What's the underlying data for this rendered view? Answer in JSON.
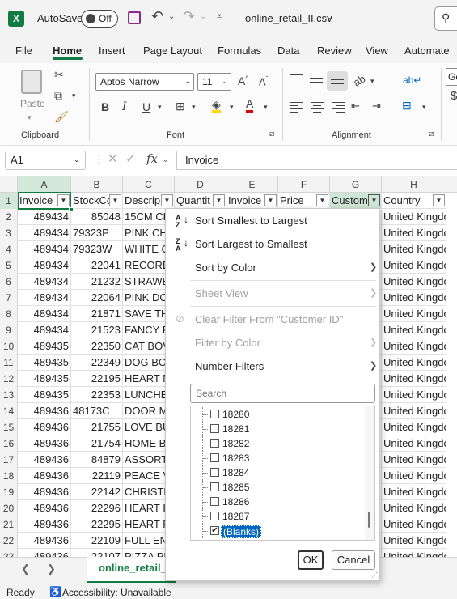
{
  "titlebar": {
    "logo": "X",
    "autosave_label": "AutoSave",
    "autosave_state": "Off",
    "file_name": "online_retail_II.csv",
    "icons": [
      "excel-logo-icon",
      "save-icon",
      "undo-icon",
      "redo-icon",
      "customize-qat-icon",
      "search-icon"
    ]
  },
  "ribbon_tabs": [
    "File",
    "Home",
    "Insert",
    "Page Layout",
    "Formulas",
    "Data",
    "Review",
    "View",
    "Automate"
  ],
  "ribbon": {
    "clipboard": {
      "label": "Clipboard",
      "paste": "Paste"
    },
    "font": {
      "label": "Font",
      "name": "Aptos Narrow",
      "size": "11",
      "bold": "B",
      "italic": "I",
      "underline": "U"
    },
    "alignment": {
      "label": "Alignment"
    },
    "next_group_stub": "Ge"
  },
  "formula_bar": {
    "namebox": "A1",
    "fx": "fx",
    "formula": "Invoice"
  },
  "grid": {
    "columns": [
      "A",
      "B",
      "C",
      "D",
      "E",
      "F",
      "G",
      "H"
    ],
    "headers": [
      "Invoice",
      "StockCo",
      "Descrip",
      "Quantit",
      "Invoice",
      "Price",
      "Custom",
      "Country"
    ],
    "rows": [
      {
        "n": "1"
      },
      {
        "n": "2",
        "a": "489434",
        "b": "85048",
        "c": "15CM CH",
        "h": "United Kingdom"
      },
      {
        "n": "3",
        "a": "489434",
        "b": "79323P",
        "c": "PINK CH",
        "h": "United Kingdom"
      },
      {
        "n": "4",
        "a": "489434",
        "b": "79323W",
        "c": " WHITE C",
        "h": "United Kingdom"
      },
      {
        "n": "5",
        "a": "489434",
        "b": "22041",
        "c": "RECORD",
        "h": "United Kingdom"
      },
      {
        "n": "6",
        "a": "489434",
        "b": "21232",
        "c": "STRAWB",
        "h": "United Kingdom"
      },
      {
        "n": "7",
        "a": "489434",
        "b": "22064",
        "c": "PINK DO",
        "h": "United Kingdom"
      },
      {
        "n": "8",
        "a": "489434",
        "b": "21871",
        "c": "SAVE TH",
        "h": "United Kingdom"
      },
      {
        "n": "9",
        "a": "489434",
        "b": "21523",
        "c": "FANCY F",
        "h": "United Kingdom"
      },
      {
        "n": "10",
        "a": "489435",
        "b": "22350",
        "c": "CAT BOV",
        "h": "United Kingdom"
      },
      {
        "n": "11",
        "a": "489435",
        "b": "22349",
        "c": "DOG BO",
        "h": "United Kingdom"
      },
      {
        "n": "12",
        "a": "489435",
        "b": "22195",
        "c": "HEART M",
        "h": "United Kingdom"
      },
      {
        "n": "13",
        "a": "489435",
        "b": "22353",
        "c": "LUNCHB",
        "h": "United Kingdom"
      },
      {
        "n": "14",
        "a": "489436",
        "b": "48173C",
        "c": "DOOR M",
        "h": "United Kingdom"
      },
      {
        "n": "15",
        "a": "489436",
        "b": "21755",
        "c": "LOVE BU",
        "h": "United Kingdom"
      },
      {
        "n": "16",
        "a": "489436",
        "b": "21754",
        "c": "HOME B",
        "h": "United Kingdom"
      },
      {
        "n": "17",
        "a": "489436",
        "b": "84879",
        "c": "ASSORT",
        "h": "United Kingdom"
      },
      {
        "n": "18",
        "a": "489436",
        "b": "22119",
        "c": " PEACE V",
        "h": "United Kingdom"
      },
      {
        "n": "19",
        "a": "489436",
        "b": "22142",
        "c": "CHRISTN",
        "h": "United Kingdom"
      },
      {
        "n": "20",
        "a": "489436",
        "b": "22296",
        "c": "HEART IV",
        "h": "United Kingdom"
      },
      {
        "n": "21",
        "a": "489436",
        "b": "22295",
        "c": "HEART F",
        "h": "United Kingdom"
      },
      {
        "n": "22",
        "a": "489436",
        "b": "22109",
        "c": "FULL EN",
        "h": "United Kingdom"
      },
      {
        "n": "23",
        "a": "489436",
        "b": "22107",
        "c": "PIZZA PL",
        "h": "United Kingdom"
      }
    ]
  },
  "filter_menu": {
    "sort_asc": "Sort Smallest to Largest",
    "sort_desc": "Sort Largest to Smallest",
    "sort_by_color": "Sort by Color",
    "sheet_view": "Sheet View",
    "clear_filter": "Clear Filter From \"Customer ID\"",
    "filter_by_color": "Filter by Color",
    "number_filters": "Number Filters",
    "search_placeholder": "Search",
    "values": [
      {
        "label": "18280",
        "checked": false
      },
      {
        "label": "18281",
        "checked": false
      },
      {
        "label": "18282",
        "checked": false
      },
      {
        "label": "18283",
        "checked": false
      },
      {
        "label": "18284",
        "checked": false
      },
      {
        "label": "18285",
        "checked": false
      },
      {
        "label": "18286",
        "checked": false
      },
      {
        "label": "18287",
        "checked": false
      },
      {
        "label": "(Blanks)",
        "checked": true
      }
    ],
    "ok": "OK",
    "cancel": "Cancel"
  },
  "sheet_tab": "online_retail_",
  "status": {
    "ready": "Ready",
    "accessibility": "Accessibility: Unavailable"
  },
  "colors": {
    "excel_green": "#107c41",
    "selection_blue": "#0067c0"
  }
}
